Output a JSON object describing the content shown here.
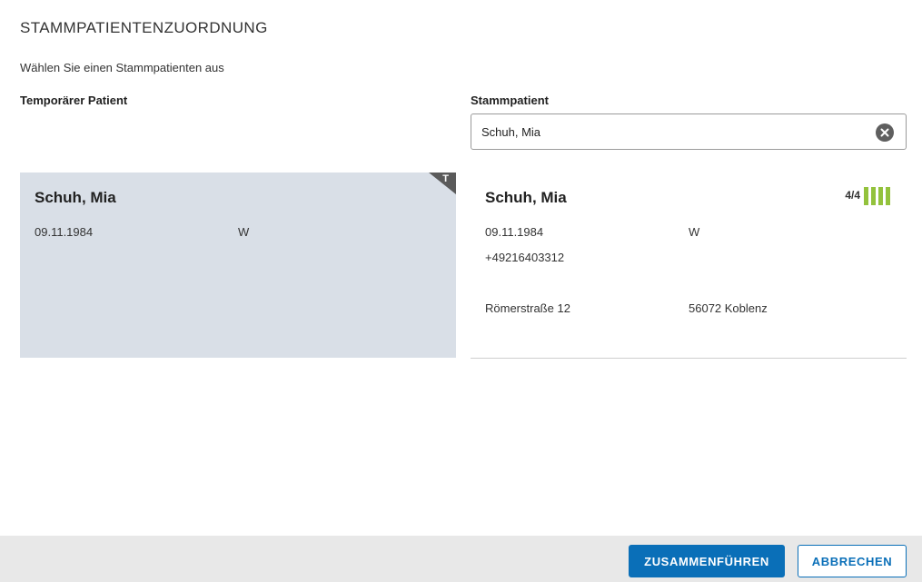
{
  "dialog": {
    "title": "STAMMPATIENTENZUORDNUNG",
    "instruction": "Wählen Sie einen Stammpatienten aus"
  },
  "columns": {
    "temporary_label": "Temporärer Patient",
    "master_label": "Stammpatient"
  },
  "search": {
    "value": "Schuh, Mia",
    "placeholder": ""
  },
  "temporary_patient": {
    "badge": "T",
    "name": "Schuh, Mia",
    "birthdate": "09.11.1984",
    "gender": "W"
  },
  "master_patient": {
    "name": "Schuh, Mia",
    "match_score": "4/4",
    "match_level": 4,
    "match_max": 4,
    "birthdate": "09.11.1984",
    "gender": "W",
    "phone": "+49216403312",
    "street": "Römerstraße 12",
    "city": "56072 Koblenz"
  },
  "footer": {
    "merge_label": "ZUSAMMENFÜHREN",
    "cancel_label": "ABBRECHEN"
  },
  "colors": {
    "primary": "#0a6fb8",
    "match_green": "#93c23c",
    "temp_card_bg": "#d9dfe7",
    "badge_bg": "#5a5a5a"
  },
  "icons": {
    "clear": "clear-circle-x-icon"
  }
}
